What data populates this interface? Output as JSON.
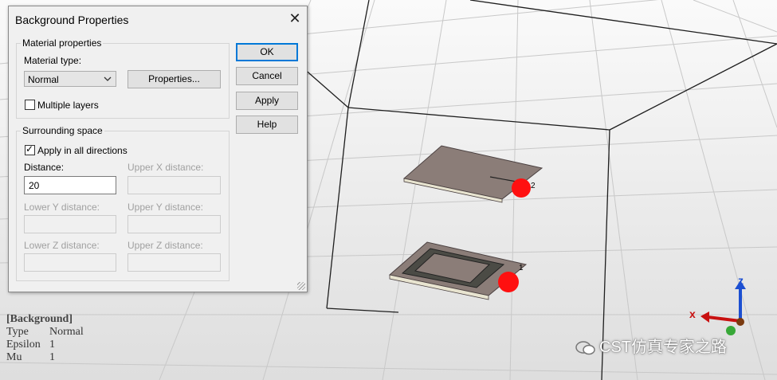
{
  "dialog": {
    "title": "Background Properties",
    "material_group": "Material properties",
    "material_type_label": "Material type:",
    "material_type_value": "Normal",
    "properties_button": "Properties...",
    "multiple_layers_label": "Multiple layers",
    "multiple_layers_checked": false,
    "surrounding_group": "Surrounding space",
    "apply_all_label": "Apply in all directions",
    "apply_all_checked": true,
    "distance_label": "Distance:",
    "distance_value": "20",
    "upper_x_label": "Upper X distance:",
    "lower_y_label": "Lower Y distance:",
    "upper_y_label": "Upper Y distance:",
    "lower_z_label": "Lower Z distance:",
    "upper_z_label": "Upper Z distance:",
    "buttons": {
      "ok": "OK",
      "cancel": "Cancel",
      "apply": "Apply",
      "help": "Help"
    }
  },
  "info": {
    "header": "[Background]",
    "rows": [
      {
        "key": "Type",
        "value": "Normal"
      },
      {
        "key": "Epsilon",
        "value": "1"
      },
      {
        "key": "Mu",
        "value": "1"
      }
    ]
  },
  "ports": {
    "upper": "2",
    "lower": "1"
  },
  "axes": {
    "x": "x",
    "z": "z"
  },
  "watermark": "CST仿真专家之路",
  "colors": {
    "port": "#ff1010",
    "board": "#8b7d78",
    "grid": "#c8c8c8",
    "box": "#222222"
  }
}
